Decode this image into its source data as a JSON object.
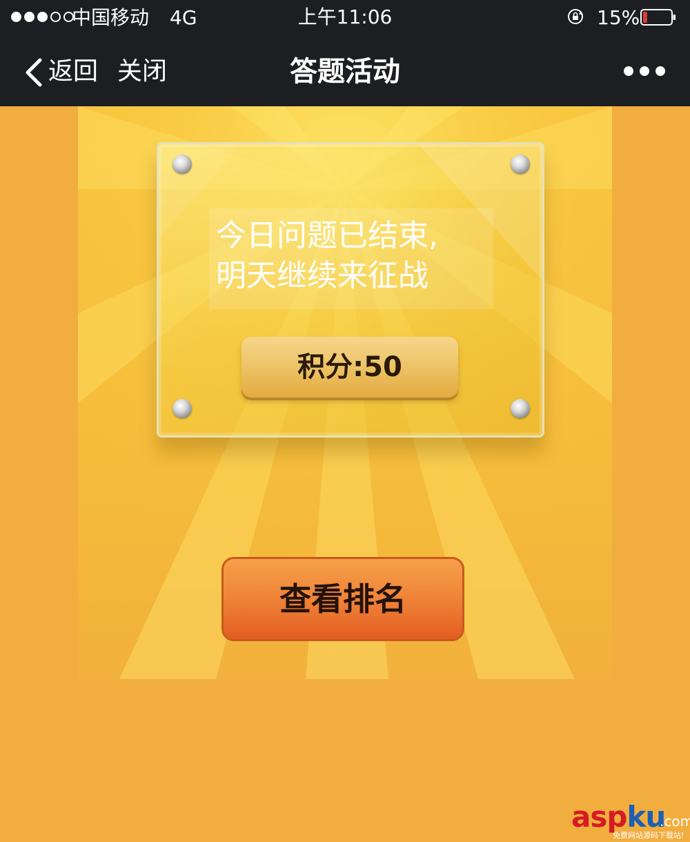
{
  "status_bar": {
    "carrier": "中国移动",
    "network": "4G",
    "time": "上午11:06",
    "battery_percent": "15%",
    "battery_level": 0.15,
    "signal_bars_filled": 3,
    "signal_bars_total": 5
  },
  "nav": {
    "back_label": "返回",
    "close_label": "关闭",
    "title": "答题活动",
    "more_icon": "more-dots-icon"
  },
  "panel": {
    "message_line1": "今日问题已结束,",
    "message_line2": "明天继续来征战",
    "score_label": "积分:50"
  },
  "actions": {
    "view_ranking": "查看排名"
  },
  "watermark": {
    "brand_red": "asp",
    "brand_blue": "ku",
    "dotcom": ".com",
    "tagline": "免费网站源码下载站!"
  },
  "colors": {
    "topbar": "#1d1e21",
    "background": "#f2ad3f",
    "rank_button": "#ef8338",
    "score_button": "#eec56a",
    "battery_low": "#e23b3b"
  }
}
